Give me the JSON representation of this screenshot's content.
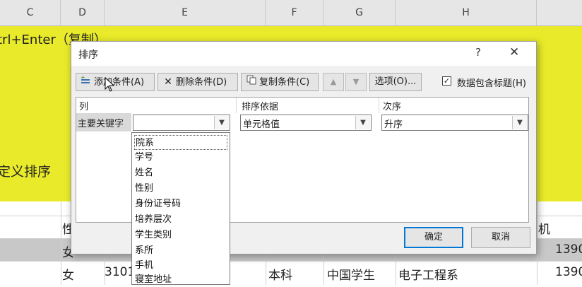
{
  "sheet": {
    "columns": [
      "C",
      "D",
      "E",
      "F",
      "G",
      "H"
    ],
    "yellow_line1": "trl+Enter（复制）",
    "yellow_line2": "定义排序",
    "row1": {
      "d": "性",
      "i": "机"
    },
    "row2": {
      "d": "女",
      "i": "1390"
    },
    "row3": {
      "d": "女",
      "e": "3101",
      "f": "本科",
      "g": "中国学生",
      "h": "电子工程系",
      "i": "1390"
    }
  },
  "dialog": {
    "title": "排序",
    "help": "?",
    "close": "✕",
    "toolbar": {
      "add": "添加条件(A)",
      "delete": "删除条件(D)",
      "copy": "复制条件(C)",
      "options": "选项(O)...",
      "header_checkbox_label": "数据包含标题(H)",
      "header_checked": true
    },
    "grid": {
      "col_header": "列",
      "sort_on_header": "排序依据",
      "order_header": "次序",
      "row_label": "主要关键字",
      "column_value": "",
      "sort_on_value": "单元格值",
      "order_value": "升序"
    },
    "ok": "确定",
    "cancel": "取消"
  },
  "dropdown_items": [
    "院系",
    "学号",
    "姓名",
    "性别",
    "身份证号码",
    "培养层次",
    "学生类别",
    "系所",
    "手机",
    "寝室地址"
  ],
  "icons": {
    "add": "add-condition-icon",
    "delete": "delete-icon",
    "copy": "copy-icon",
    "up": "move-up-icon",
    "down": "move-down-icon",
    "dropdown": "chevron-down-icon"
  }
}
